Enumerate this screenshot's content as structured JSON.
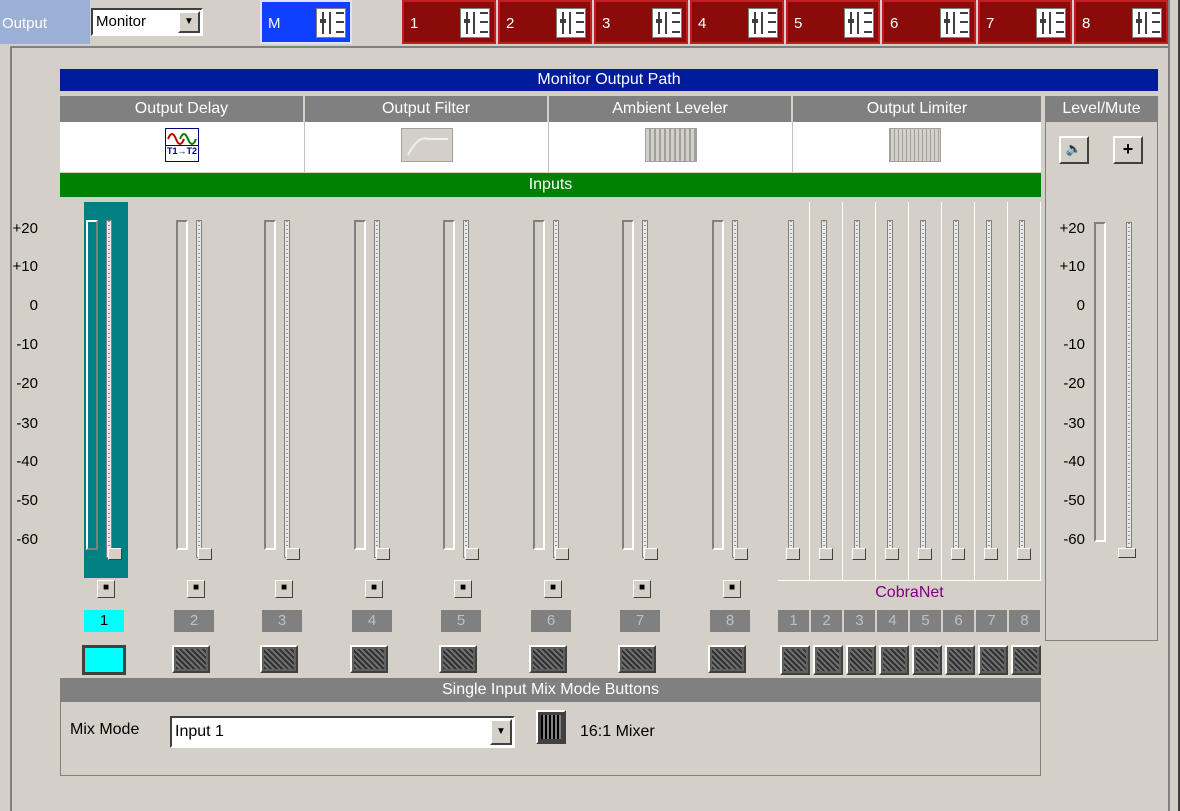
{
  "topbar": {
    "output_label": "Output",
    "output_select": "Monitor",
    "monitor_tab": "M",
    "output_tabs": [
      "1",
      "2",
      "3",
      "4",
      "5",
      "6",
      "7",
      "8"
    ]
  },
  "path": {
    "title": "Monitor Output Path",
    "stages": [
      "Output Delay",
      "Output Filter",
      "Ambient Leveler",
      "Output Limiter"
    ],
    "delay_icon_text": "T1→T2",
    "level_mute": "Level/Mute"
  },
  "inputs": {
    "title": "Inputs",
    "scale": [
      "+20",
      "+10",
      "0",
      "-10",
      "-20",
      "-30",
      "-40",
      "-50",
      "-60"
    ],
    "channels": [
      "1",
      "2",
      "3",
      "4",
      "5",
      "6",
      "7",
      "8"
    ],
    "selected_channel": "1",
    "cobranet_label": "CobraNet",
    "cobranet_channels": [
      "1",
      "2",
      "3",
      "4",
      "5",
      "6",
      "7",
      "8"
    ]
  },
  "mix": {
    "section_title": "Single Input Mix Mode Buttons",
    "mode_label": "Mix Mode",
    "mode_value": "Input 1",
    "mixer_label": "16:1 Mixer"
  },
  "colors": {
    "monitor_tab": "#1040ff",
    "output_tab": "#8b0a0a",
    "path_bar": "#001c9c",
    "inputs_bar": "#008000",
    "selected_channel": "#00ffff",
    "selected_strip": "#008080",
    "cobranet_text": "#800080"
  }
}
